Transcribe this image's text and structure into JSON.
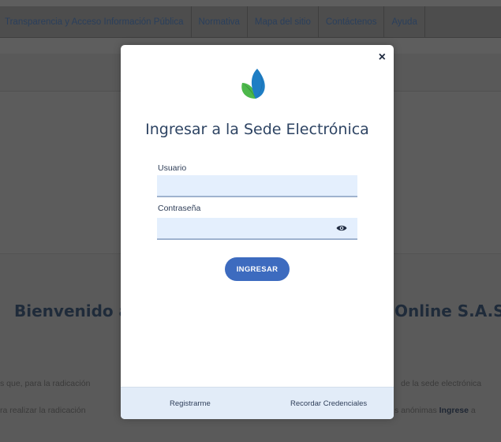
{
  "nav": {
    "items": [
      "Transparencia y Acceso Información Pública",
      "Normativa",
      "Mapa del sitio",
      "Contáctenos",
      "Ayuda"
    ]
  },
  "background": {
    "welcome_left": "Bienvenido a",
    "welcome_right": "Online S.A.S.",
    "line1_left": "s que, para la radicación",
    "line1_right": "de la sede electrónica",
    "line2_left": "ra realizar la radicación",
    "line2_right": "s anónimas",
    "line2_right_bold": "Ingrese",
    "line2_right_tail": "a"
  },
  "modal": {
    "close_label": "×",
    "title": "Ingresar a la Sede Electrónica",
    "usuario_label": "Usuario",
    "usuario_value": "",
    "password_label": "Contraseña",
    "password_value": "",
    "submit_label": "INGRESAR",
    "register_label": "Registrarme",
    "recover_label": "Recordar Credenciales"
  },
  "colors": {
    "primary_button": "#3d6bbf",
    "input_bg": "#e4effd",
    "footer_bg": "#e2ecf8",
    "title_text": "#2e4463",
    "logo_blue": "#1f7ec4",
    "logo_green": "#4db84b"
  },
  "icons": {
    "close": "close-icon",
    "logo": "leaf-logo",
    "password_toggle": "eye-icon"
  }
}
